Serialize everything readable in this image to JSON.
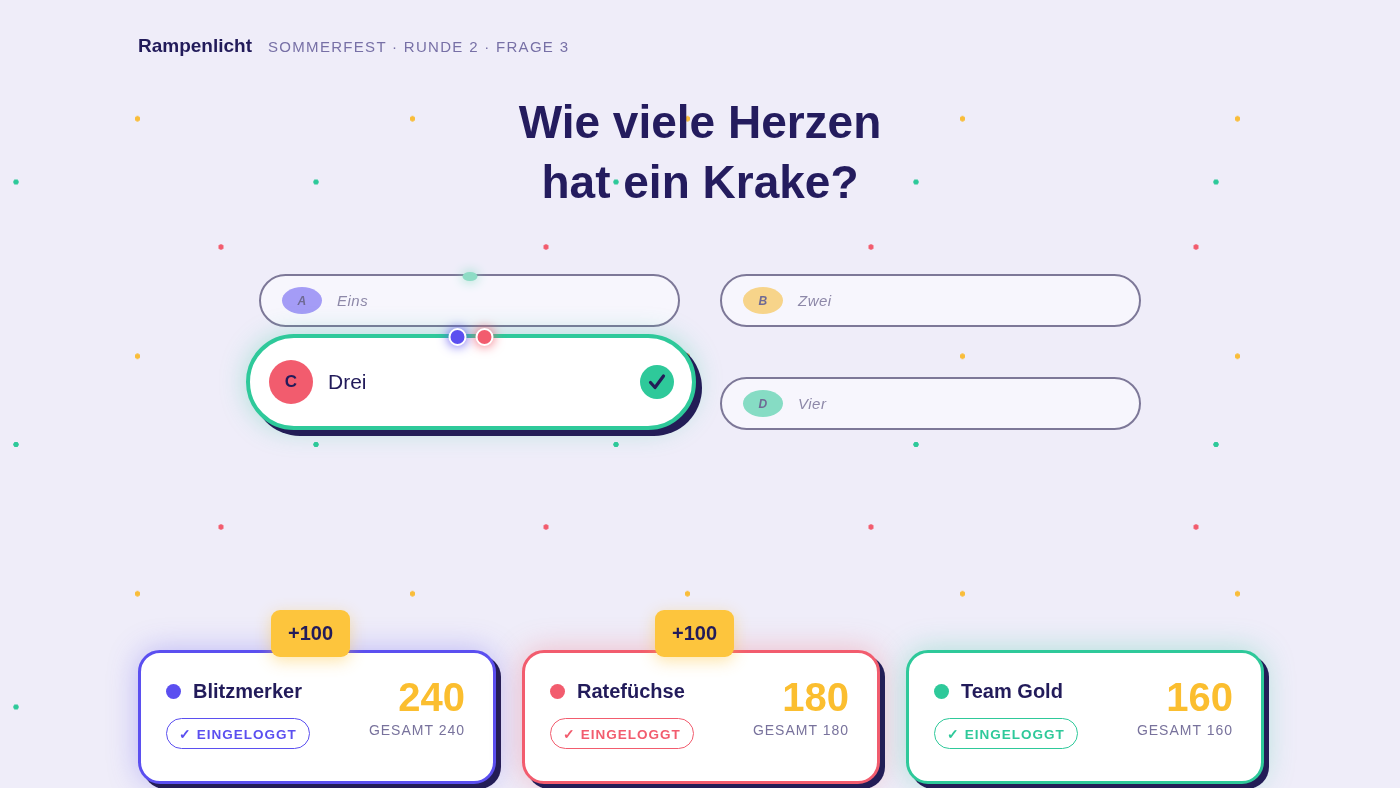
{
  "header": {
    "brand": "Rampenlicht",
    "breadcrumb": "SOMMERFEST · RUNDE 2 · FRAGE 3"
  },
  "question": "Wie viele Herzen hat ein Krake?",
  "answers": [
    {
      "letter": "A",
      "text": "Eins",
      "color": "#a49cf6",
      "correct": false,
      "picks": [
        {
          "color": "#8edcc5"
        }
      ]
    },
    {
      "letter": "B",
      "text": "Zwei",
      "color": "#f7d48a",
      "correct": false
    },
    {
      "letter": "C",
      "text": "Drei",
      "color": "#f25c6e",
      "correct": true,
      "picks": [
        {
          "color": "#5b4ff0"
        },
        {
          "color": "#f25c6e"
        }
      ]
    },
    {
      "letter": "D",
      "text": "Vier",
      "color": "#86dcc4",
      "correct": false
    }
  ],
  "teams": [
    {
      "name": "Blitzmerker",
      "color": "#5b4ff0",
      "bonus": "+100",
      "status": "✓ EINGELOGGT",
      "score": "240",
      "total": "GESAMT 240"
    },
    {
      "name": "Ratefüchse",
      "color": "#f25c6e",
      "bonus": "+100",
      "status": "✓ EINGELOGGT",
      "score": "180",
      "total": "GESAMT 180"
    },
    {
      "name": "Team Gold",
      "color": "#2ec99a",
      "status": "✓ EINGELOGGT",
      "score": "160",
      "total": "GESAMT 160"
    }
  ]
}
